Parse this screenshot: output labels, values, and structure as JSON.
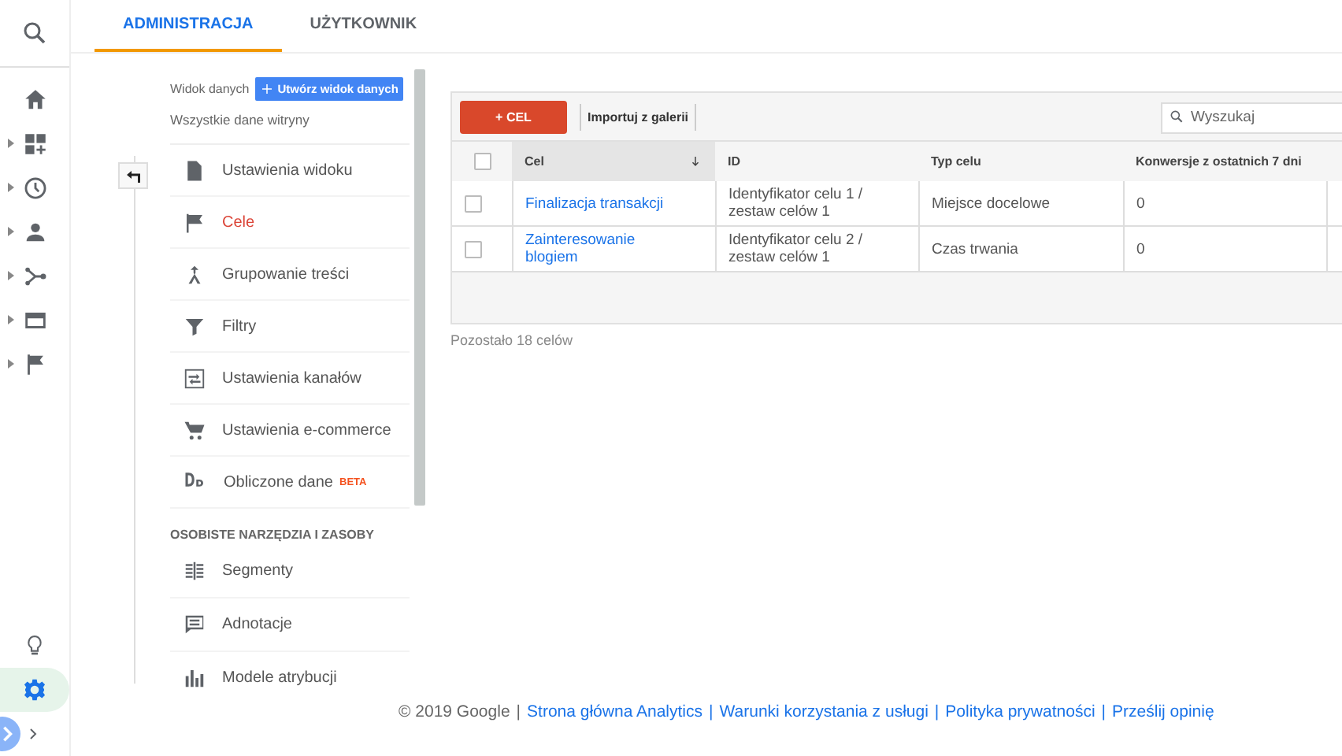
{
  "rail": {
    "top_items": [
      {
        "expandable": false
      },
      {
        "expandable": true
      },
      {
        "expandable": true
      },
      {
        "expandable": true
      },
      {
        "expandable": true
      },
      {
        "expandable": true
      },
      {
        "expandable": true
      }
    ],
    "bottom_items": [
      {
        "selected": false
      },
      {
        "selected": true
      }
    ]
  },
  "tabs": [
    {
      "label": "ADMINISTRACJA",
      "selected": true
    },
    {
      "label": "UŻYTKOWNIK",
      "selected": false
    }
  ],
  "view": {
    "label": "Widok danych",
    "create_button": "Utwórz widok danych",
    "name": "Wszystkie dane witryny"
  },
  "menu": [
    {
      "kind": "item",
      "label": "Ustawienia widoku",
      "selected": false
    },
    {
      "kind": "item",
      "label": "Cele",
      "selected": true
    },
    {
      "kind": "item",
      "label": "Grupowanie treści",
      "selected": false
    },
    {
      "kind": "item",
      "label": "Filtry",
      "selected": false
    },
    {
      "kind": "item",
      "label": "Ustawienia kanałów",
      "selected": false
    },
    {
      "kind": "item",
      "label": "Ustawienia e-commerce",
      "selected": false
    },
    {
      "kind": "item",
      "label": "Obliczone dane",
      "selected": false,
      "badge": "BETA"
    },
    {
      "kind": "heading",
      "label": "OSOBISTE NARZĘDZIA I ZASOBY"
    },
    {
      "kind": "item",
      "label": "Segmenty",
      "selected": false
    },
    {
      "kind": "item",
      "label": "Adnotacje",
      "selected": false
    },
    {
      "kind": "item",
      "label": "Modele atrybucji",
      "selected": false
    }
  ],
  "goals": {
    "new_button": "+ CEL",
    "select_all": {
      "checked": false
    },
    "import_button": "Importuj z galerii",
    "search": {
      "placeholder": "Wyszukaj"
    },
    "columns": [
      {
        "label": "Cel",
        "sorted": true
      },
      {
        "label": "ID",
        "sorted": false
      },
      {
        "label": "Typ celu",
        "sorted": false
      },
      {
        "label": "Konwersje z ostatnich 7 dni",
        "sorted": false
      }
    ],
    "rows": [
      {
        "checked": false,
        "cells": [
          "Finalizacja transakcji",
          "Identyfikator celu 1 / zestaw celów 1",
          "Miejsce docelowe",
          "0"
        ]
      },
      {
        "checked": false,
        "cells": [
          "Zainteresowanie blogiem",
          "Identyfikator celu 2 / zestaw celów 1",
          "Czas trwania",
          "0"
        ]
      }
    ],
    "remaining": "Pozostało 18 celów"
  },
  "footer": {
    "copyright": "© 2019 Google",
    "links": [
      {
        "separator": "|",
        "label": "Strona główna Analytics"
      },
      {
        "separator": "|",
        "label": "Warunki korzystania z usługi"
      },
      {
        "separator": "|",
        "label": "Polityka prywatności"
      },
      {
        "separator": "|",
        "label": "Prześlij opinię"
      }
    ]
  }
}
